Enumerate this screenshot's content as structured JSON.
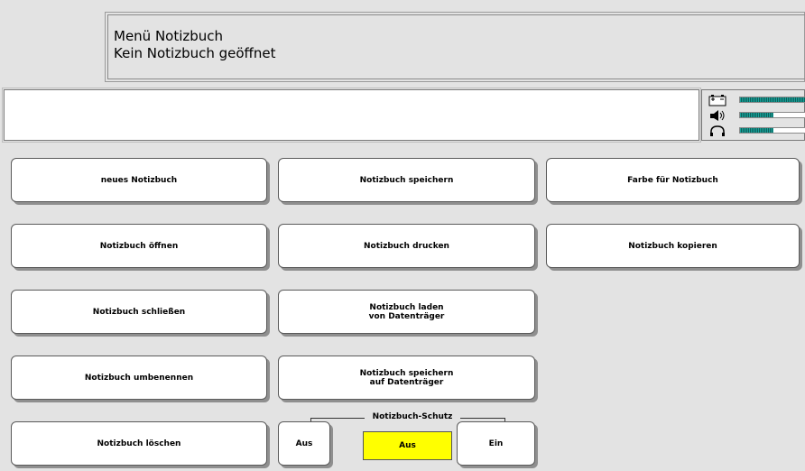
{
  "header": {
    "line1": "Menü Notizbuch",
    "line2": "Kein Notizbuch geöffnet"
  },
  "display": {
    "text": ""
  },
  "status": {
    "battery": {
      "icon": "battery-icon",
      "level": 1.0
    },
    "volume": {
      "icon": "speaker-icon",
      "level": 0.5
    },
    "headphone": {
      "icon": "headphone-icon",
      "level": 0.5
    },
    "meter_color": "#1aa29a"
  },
  "buttons": {
    "new_notebook": "neues Notizbuch",
    "open_notebook": "Notizbuch öffnen",
    "close_notebook": "Notizbuch schließen",
    "rename_notebook": "Notizbuch umbenennen",
    "delete_notebook": "Notizbuch löschen",
    "save_notebook": "Notizbuch speichern",
    "print_notebook": "Notizbuch drucken",
    "load_from_disk": "Notizbuch laden\nvon Datenträger",
    "save_to_disk": "Notizbuch speichern\nauf Datenträger",
    "color_notebook": "Farbe für Notizbuch",
    "copy_notebook": "Notizbuch kopieren"
  },
  "protection": {
    "label": "Notizbuch-Schutz",
    "left_option": "Aus",
    "current_value": "Aus",
    "right_option": "Ein",
    "highlight_color": "#ffff00"
  }
}
